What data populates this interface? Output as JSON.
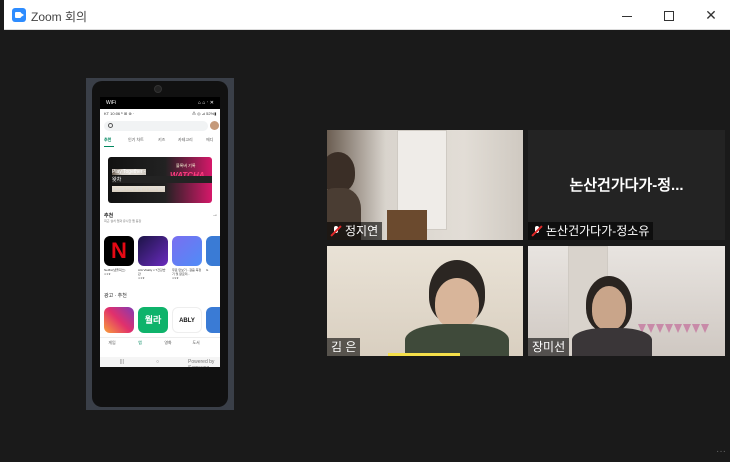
{
  "window": {
    "title": "Zoom 회의",
    "controls": {
      "minimize": "",
      "maximize": "",
      "close": "✕"
    }
  },
  "shared_screen": {
    "status_left": "WiFi",
    "status_right": "⌂ ⌂ ‧ ✕",
    "sub_left": "KT 10:06 ᵇ ⊞ ⊛ ·",
    "sub_right": "⁂ ◎ ⊿ 52%▮",
    "tabs": [
      "추천",
      "인기 차트",
      "키즈",
      "카테고리",
      "에디"
    ],
    "banner": {
      "line1": "Play Together -",
      "line2": "왓차",
      "line3": "Google Play 결제 시 15% 할인",
      "watermark": "블록버 기록",
      "logo": "WATCHA"
    },
    "section_title": "추천",
    "section_sub": "최근 설치 앱과 유사한 앱 등장",
    "section_arrow": "→",
    "apps": [
      {
        "name": "Netflix(넷플릭스)",
        "rating": "4.3★"
      },
      {
        "name": "AIA Vitality x T건강습관",
        "rating": "4.3★"
      },
      {
        "name": "무료 만보기 - 걸음 측정기 및 칼로리...",
        "rating": "4.9★"
      },
      {
        "name": "G",
        "rating": ""
      }
    ],
    "section2": "광고 · 추천",
    "apps2": [
      "",
      "월라",
      "ABLY"
    ],
    "bottom_nav": [
      "게임",
      "앱",
      "영화",
      "도서"
    ],
    "badge": "Powered by Samsung"
  },
  "participants": [
    {
      "name": "정지연",
      "muted": true
    },
    {
      "name": "논산건가다가-정소유",
      "muted": true,
      "display_name": "논산건가다가-정..."
    },
    {
      "name": "김 은",
      "muted": false
    },
    {
      "name": "장미선",
      "muted": false
    }
  ],
  "footer_dots": "···",
  "colors": {
    "zoom_blue": "#2d8cff",
    "mute_red": "#e02828",
    "play_green": "#01875f",
    "active_speaker": "#f5e04a"
  }
}
